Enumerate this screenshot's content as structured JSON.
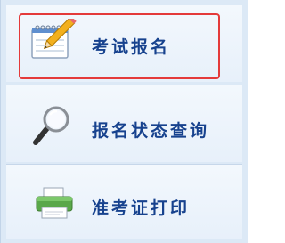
{
  "menu": {
    "items": [
      {
        "label": "考试报名",
        "icon": "notepad-pencil-icon",
        "selected": true
      },
      {
        "label": "报名状态查询",
        "icon": "magnifier-icon",
        "selected": false
      },
      {
        "label": "准考证打印",
        "icon": "printer-icon",
        "selected": false
      }
    ]
  },
  "colors": {
    "label_text": "#17428e",
    "panel_background": "#dce9f6",
    "selection_outline": "#e43a3a"
  }
}
